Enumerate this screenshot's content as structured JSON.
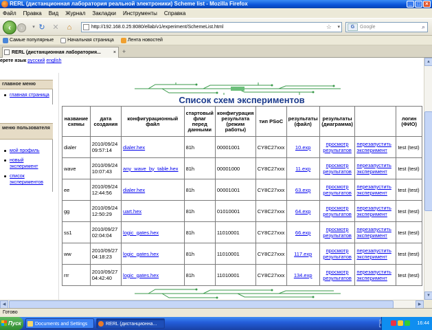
{
  "window": {
    "title": "RERL (дистанционная лаборатория реальной электроники) Scheme list - Mozilla Firefox"
  },
  "menu": [
    "Файл",
    "Правка",
    "Вид",
    "Журнал",
    "Закладки",
    "Инструменты",
    "Справка"
  ],
  "nav": {
    "url": "http://192.168.0.25:8080/ellab/v1/experiment/SchemeList.html",
    "search_placeholder": "Google"
  },
  "bookmarks": [
    "Самые популярные",
    "Начальная страница",
    "Лента новостей"
  ],
  "tab": {
    "label": "RERL (дистанционная лаборатория..."
  },
  "page": {
    "lang_prefix": "ерете язык",
    "lang_ru": "русский",
    "lang_en": "english",
    "title": "Список схем экспериментов"
  },
  "sidebar": {
    "main_menu_title": "главное меню",
    "main_menu_items": [
      "главная страница"
    ],
    "user_menu_title": "меню пользователя",
    "user_menu_items": [
      "мой профиль",
      "новый эксперимент",
      "список экспериментов"
    ]
  },
  "table": {
    "headers": [
      "название схемы",
      "дата создания",
      "конфигурационный файл",
      "стартовый флаг перед данными",
      "конфигурация результата (режим работы)",
      "тип PSoC",
      "результаты (файл)",
      "результаты (диаграмма)",
      "",
      "логин (ФИО)"
    ],
    "rows": [
      {
        "name": "dialer",
        "date": "2010/09/24 09:57:14",
        "file": "dialer.hex",
        "flag": "81h",
        "config": "00001001",
        "psoc": "CY8C27xxx",
        "result_file": "10.exp",
        "view": "просмотр результатов",
        "restart": "перезапустить эксперимент",
        "login": "test (test)"
      },
      {
        "name": "wave",
        "date": "2010/09/24 10:07:43",
        "file": "any_wave_by_table.hex",
        "flag": "81h",
        "config": "00001000",
        "psoc": "CY8C27xxx",
        "result_file": "11.exp",
        "view": "просмотр результатов",
        "restart": "перезапустить эксперимент",
        "login": "test (test)"
      },
      {
        "name": "ee",
        "date": "2010/09/24 12:44:56",
        "file": "dialer.hex",
        "flag": "81h",
        "config": "00001001",
        "psoc": "CY8C27xxx",
        "result_file": "63.exp",
        "view": "просмотр результатов",
        "restart": "перезапустить эксперимент",
        "login": "test (test)"
      },
      {
        "name": "gg",
        "date": "2010/09/24 12:50:29",
        "file": "uart.hex",
        "flag": "81h",
        "config": "01010001",
        "psoc": "CY8C27xxx",
        "result_file": "64.exp",
        "view": "просмотр результатов",
        "restart": "перезапустить эксперимент",
        "login": "test (test)"
      },
      {
        "name": "ss1",
        "date": "2010/09/27 02:04:04",
        "file": "logic_gates.hex",
        "flag": "81h",
        "config": "11010001",
        "psoc": "CY8C27xxx",
        "result_file": "66.exp",
        "view": "просмотр результатов",
        "restart": "перезапустить эксперимент",
        "login": "test (test)"
      },
      {
        "name": "ww",
        "date": "2010/09/27 04:18:23",
        "file": "logic_gates.hex",
        "flag": "81h",
        "config": "11010001",
        "psoc": "CY8C27xxx",
        "result_file": "117.exp",
        "view": "просмотр результатов",
        "restart": "перезапустить эксперимент",
        "login": "test (test)"
      },
      {
        "name": "rrr",
        "date": "2010/09/27 04:42:40",
        "file": "logic_gates.hex",
        "flag": "81h",
        "config": "11010001",
        "psoc": "CY8C27xxx",
        "result_file": "134.exp",
        "view": "просмотр результатов",
        "restart": "перезапустить эксперимент",
        "login": "test (test)"
      }
    ]
  },
  "status": {
    "text": "Готово"
  },
  "taskbar": {
    "start": "Пуск",
    "tasks": [
      "Documents and Settings",
      "RERL (дистанционна..."
    ],
    "lang": "EN",
    "clock": "16:44"
  },
  "colors": {
    "title_blue": "#1a3a8c",
    "link": "#0000ee",
    "circuit_green": "#3a9a4a"
  }
}
